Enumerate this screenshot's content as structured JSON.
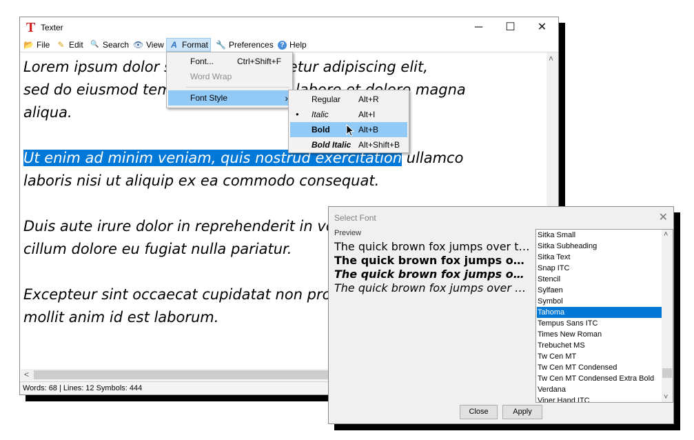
{
  "window": {
    "title": "Texter",
    "app_icon_glyph": "T",
    "controls": {
      "minimize": "─",
      "maximize": "☐",
      "close": "✕"
    }
  },
  "menubar": [
    {
      "label": "File",
      "icon": "folder-icon",
      "glyph": "📂"
    },
    {
      "label": "Edit",
      "icon": "pencil-icon",
      "glyph": "✎"
    },
    {
      "label": "Search",
      "icon": "magnifier-icon",
      "glyph": "🔍"
    },
    {
      "label": "View",
      "icon": "eye-icon",
      "glyph": "👁"
    },
    {
      "label": "Format",
      "icon": "format-icon",
      "glyph": "A"
    },
    {
      "label": "Preferences",
      "icon": "wrench-icon",
      "glyph": "🔧"
    },
    {
      "label": "Help",
      "icon": "help-icon",
      "glyph": "?"
    }
  ],
  "editor": {
    "lines": [
      "Lorem ipsum dolor sit amet, consectetur adipiscing elit,",
      "sed do eiusmod tempor incididunt ut labore et dolore magna",
      "aliqua.",
      "Ut enim ad minim veniam, quis nostrud exercitation",
      " ullamco",
      "laboris nisi ut aliquip ex ea commodo consequat.",
      "Duis aute irure dolor in reprehenderit in voluptate velit esse",
      "cillum dolore eu fugiat nulla pariatur.",
      "Excepteur sint occaecat cupidatat non proident, sunt in culpa qui officia deserunt",
      "mollit anim id est laborum."
    ]
  },
  "scroll": {
    "up": "˄",
    "left": "<"
  },
  "status": "Words: 68 | Lines: 12 Symbols: 444",
  "format_menu": {
    "font_label": "Font...",
    "font_shortcut": "Ctrl+Shift+F",
    "wordwrap_label": "Word Wrap",
    "fontstyle_label": "Font Style",
    "submenu_arrow": "›"
  },
  "fontstyle_menu": {
    "bullet": "●",
    "regular_label": "Regular",
    "regular_shortcut": "Alt+R",
    "italic_label": "Italic",
    "italic_shortcut": "Alt+I",
    "bold_label": "Bold",
    "bold_shortcut": "Alt+B",
    "bolditalic_label": "Bold Italic",
    "bolditalic_shortcut": "Alt+Shift+B"
  },
  "select_font": {
    "title": "Select Font",
    "close_glyph": "✕",
    "preview_label": "Preview",
    "preview_lines": [
      "The quick brown fox jumps over the lazy dog",
      "The quick brown fox jumps over the lazy dog",
      "The quick brown fox jumps over the lazy dog",
      "The quick brown fox jumps over the lazy dog"
    ],
    "fonts": [
      "Sitka Small",
      "Sitka Subheading",
      "Sitka Text",
      "Snap ITC",
      "Stencil",
      "Sylfaen",
      "Symbol",
      "Tahoma",
      "Tempus Sans ITC",
      "Times New Roman",
      "Trebuchet MS",
      "Tw Cen MT",
      "Tw Cen MT Condensed",
      "Tw Cen MT Condensed Extra Bold",
      "Verdana",
      "Viner Hand ITC"
    ],
    "selected_font": "Tahoma",
    "scroll_up": "˄",
    "scroll_down": "˅",
    "close_button": "Close",
    "apply_button": "Apply"
  },
  "colors": {
    "selection": "#0078d7",
    "menu_highlight": "#91c9f7",
    "active_menu": "#cce4f7",
    "app_icon": "#d21a1a"
  }
}
